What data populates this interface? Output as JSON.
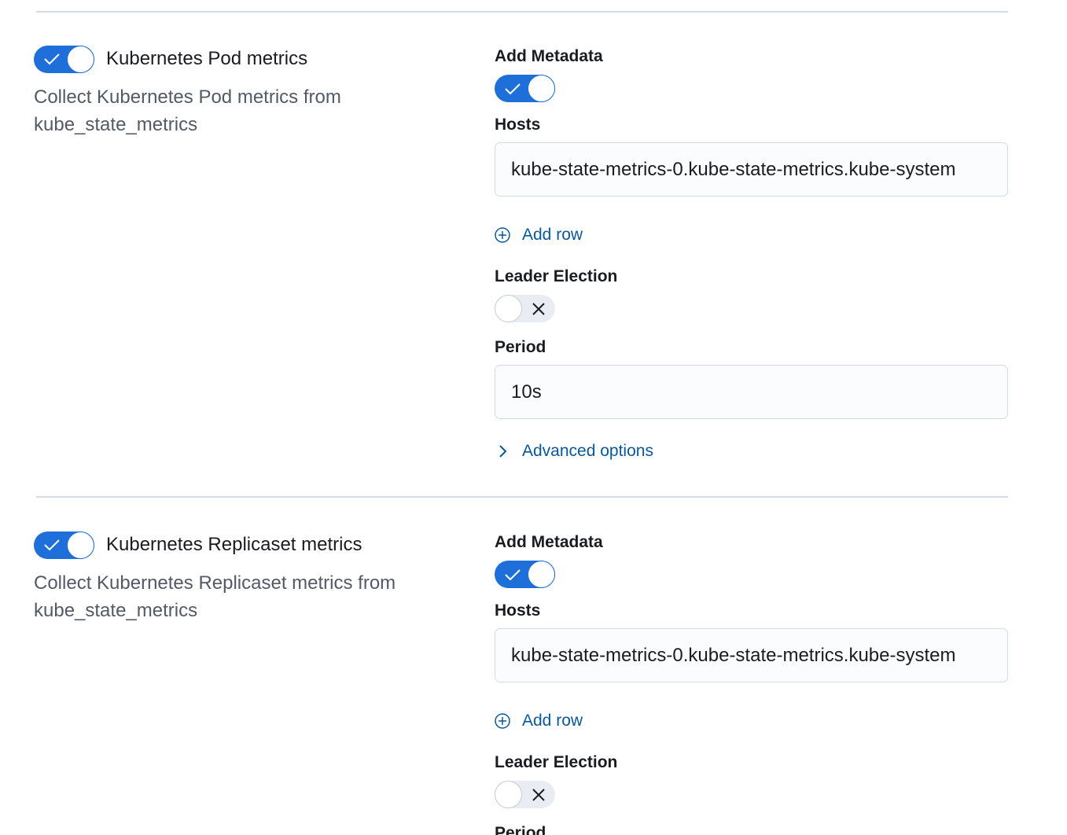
{
  "sections": [
    {
      "title": "Kubernetes Pod metrics",
      "description": "Collect Kubernetes Pod metrics from kube_state_metrics",
      "enabled": true,
      "add_metadata_label": "Add Metadata",
      "add_metadata_on": true,
      "hosts_label": "Hosts",
      "hosts_value": "kube-state-metrics-0.kube-state-metrics.kube-system",
      "add_row_label": "Add row",
      "leader_election_label": "Leader Election",
      "leader_election_on": false,
      "period_label": "Period",
      "period_value": "10s",
      "advanced_options_label": "Advanced options"
    },
    {
      "title": "Kubernetes Replicaset metrics",
      "description": "Collect Kubernetes Replicaset metrics from kube_state_metrics",
      "enabled": true,
      "add_metadata_label": "Add Metadata",
      "add_metadata_on": true,
      "hosts_label": "Hosts",
      "hosts_value": "kube-state-metrics-0.kube-state-metrics.kube-system",
      "add_row_label": "Add row",
      "leader_election_label": "Leader Election",
      "leader_election_on": false,
      "period_label": "Period"
    }
  ],
  "colors": {
    "accent": "#1e6fd9",
    "link": "#07589f",
    "muted_text": "#535966",
    "divider": "#d3dae6"
  }
}
